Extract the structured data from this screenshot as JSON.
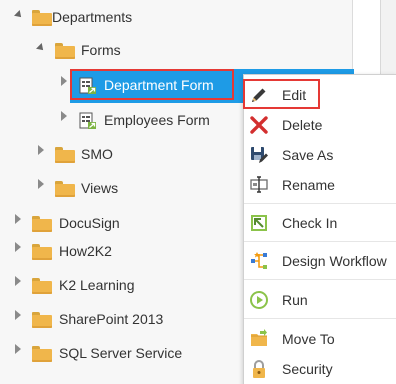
{
  "tree": {
    "items": [
      {
        "label": "Departments",
        "expanded": true,
        "icon": "folder-icon"
      },
      {
        "label": "Forms",
        "expanded": true,
        "icon": "folder-icon"
      },
      {
        "label": "Department Form",
        "selected": true,
        "icon": "form-icon"
      },
      {
        "label": "Employees Form",
        "icon": "form-icon"
      },
      {
        "label": "SMO",
        "icon": "folder-icon"
      },
      {
        "label": "Views",
        "icon": "folder-icon"
      },
      {
        "label": "DocuSign",
        "icon": "folder-icon"
      },
      {
        "label": "How2K2",
        "icon": "folder-icon"
      },
      {
        "label": "K2 Learning",
        "icon": "folder-icon"
      },
      {
        "label": "SharePoint 2013",
        "icon": "folder-icon"
      },
      {
        "label": "SQL Server Service",
        "icon": "folder-icon"
      }
    ]
  },
  "context_menu": {
    "items": [
      {
        "label": "Edit",
        "icon": "pencil-icon"
      },
      {
        "label": "Delete",
        "icon": "delete-x-icon"
      },
      {
        "label": "Save As",
        "icon": "save-as-icon"
      },
      {
        "label": "Rename",
        "icon": "rename-icon"
      },
      {
        "label": "Check In",
        "icon": "check-in-icon"
      },
      {
        "label": "Design Workflow",
        "icon": "workflow-icon"
      },
      {
        "label": "Run",
        "icon": "run-icon"
      },
      {
        "label": "Move To",
        "icon": "move-to-folder-icon"
      },
      {
        "label": "Security",
        "icon": "lock-icon"
      }
    ]
  },
  "colors": {
    "selection": "#1e9be6",
    "highlight_box": "#e53935",
    "folder": "#f0b64b"
  }
}
